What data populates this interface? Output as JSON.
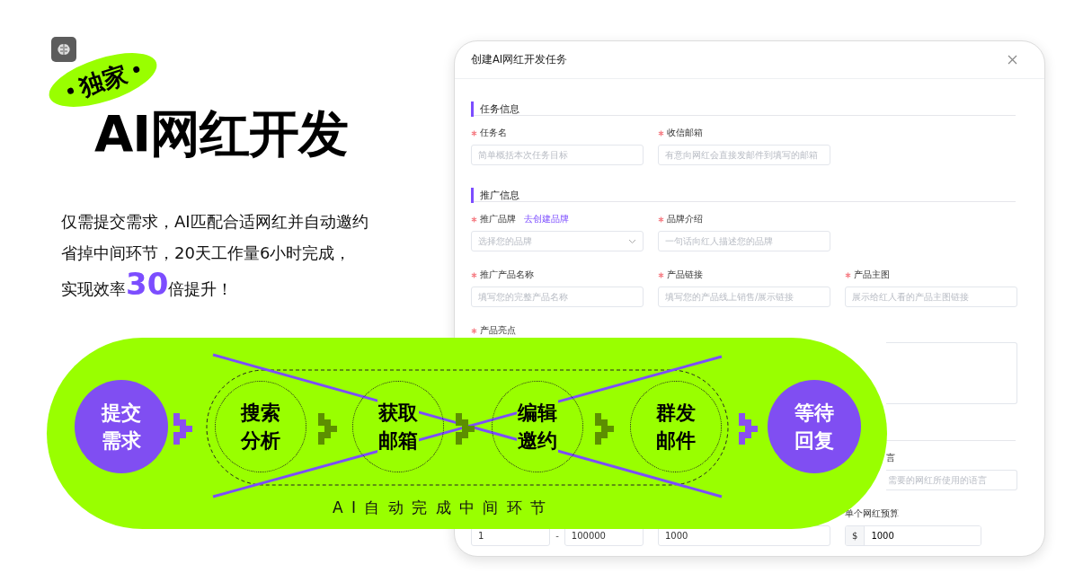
{
  "badge": {
    "label": "独家"
  },
  "headline": "AI网红开发",
  "description": [
    "仅需提交需求，AI匹配合适网红并自动邀约",
    "省掉中间环节，20天工作量6小时完成，",
    "实现效率**30**倍提升！"
  ],
  "modal": {
    "title": "创建AI网红开发任务",
    "sections": [
      {
        "title": "任务信息",
        "rows": [
          [
            {
              "kind": "input",
              "label": "任务名",
              "required": true,
              "placeholder": "简单概括本次任务目标"
            },
            {
              "kind": "input",
              "label": "收信邮箱",
              "required": true,
              "placeholder": "有意向网红会直接发邮件到填写的邮箱"
            }
          ]
        ]
      },
      {
        "title": "推广信息",
        "rows": [
          [
            {
              "kind": "select",
              "label": "推广品牌",
              "required": true,
              "link": "去创建品牌",
              "placeholder": "选择您的品牌"
            },
            {
              "kind": "input",
              "label": "品牌介绍",
              "required": true,
              "placeholder": "一句话向红人描述您的品牌"
            }
          ],
          [
            {
              "kind": "input",
              "label": "推广产品名称",
              "required": true,
              "placeholder": "填写您的完整产品名称"
            },
            {
              "kind": "input",
              "label": "产品链接",
              "required": true,
              "placeholder": "填写您的产品线上销售/展示链接"
            },
            {
              "kind": "input",
              "label": "产品主图",
              "required": true,
              "placeholder": "展示给红人看的产品主图链接"
            }
          ],
          [
            {
              "kind": "textarea",
              "label": "产品亮点",
              "required": true
            }
          ]
        ]
      },
      {
        "rows": [
          [
            {
              "kind": "blank"
            },
            {
              "kind": "blank"
            },
            {
              "kind": "partial",
              "label": "言",
              "placeholder": "需要的网红所使用的语言"
            }
          ],
          [
            {
              "kind": "range",
              "min": "1",
              "separator": "-",
              "max": "100000"
            },
            {
              "kind": "input",
              "value": "1000"
            },
            {
              "kind": "prefixed",
              "label": "单个网红预算",
              "prefix": "$",
              "value": "1000"
            }
          ]
        ]
      }
    ]
  },
  "flow": {
    "start": "提交需求",
    "steps": [
      "搜索分析",
      "获取邮箱",
      "编辑邀约",
      "群发邮件"
    ],
    "end": "等待回复",
    "caption": "A I 自 动 完 成 中 间 环 节"
  }
}
